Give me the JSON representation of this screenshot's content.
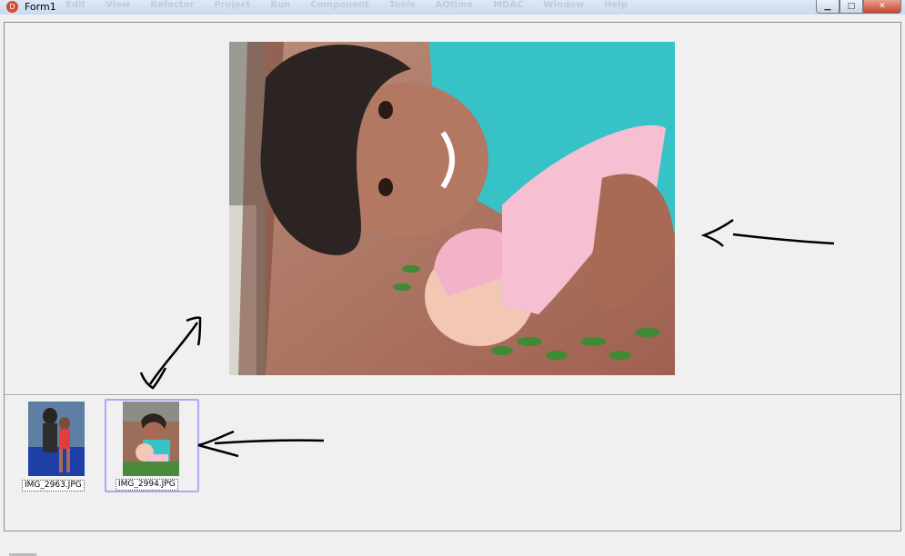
{
  "window": {
    "title": "Form1",
    "app_icon_letter": "D"
  },
  "faded_menu": [
    "Edit",
    "View",
    "Refactor",
    "Project",
    "Run",
    "Component",
    "Tools",
    "AQtime",
    "MDAC",
    "Window",
    "Help"
  ],
  "window_buttons": {
    "minimize": "▁",
    "maximize": "□",
    "close": "✕"
  },
  "preview": {
    "description_icon": "photo-preview"
  },
  "thumbnails": [
    {
      "caption": "IMG_2963.JPG",
      "selected": false
    },
    {
      "caption": "IMG_2994.JPG",
      "selected": true
    }
  ],
  "colors": {
    "selection_border": "#a9a9f5",
    "close_button": "#c7432a",
    "titlebar": "#c9d9ee"
  }
}
